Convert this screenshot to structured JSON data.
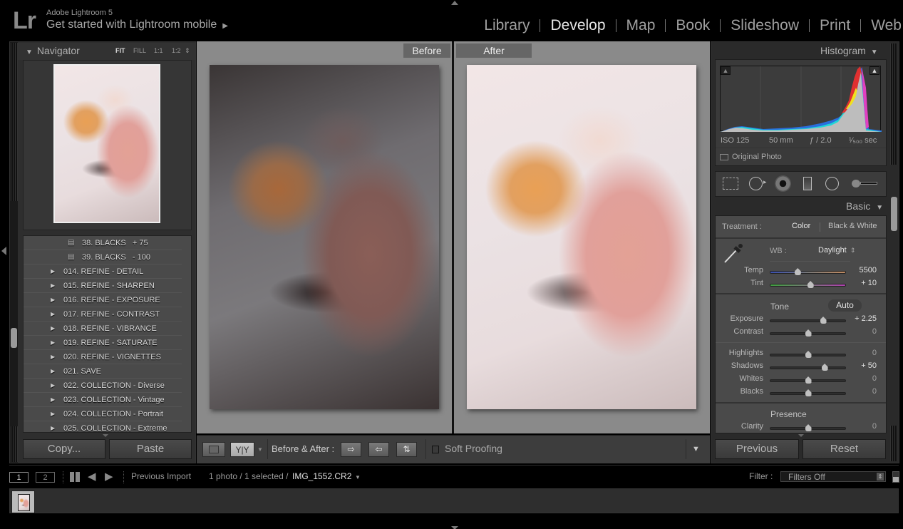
{
  "app": {
    "logo": "Lr",
    "name": "Adobe Lightroom 5",
    "mobile_link": "Get started with Lightroom mobile",
    "mobile_arrow": "▶"
  },
  "modules": [
    {
      "label": "Library",
      "active": false
    },
    {
      "label": "Develop",
      "active": true
    },
    {
      "label": "Map",
      "active": false
    },
    {
      "label": "Book",
      "active": false
    },
    {
      "label": "Slideshow",
      "active": false
    },
    {
      "label": "Print",
      "active": false
    },
    {
      "label": "Web",
      "active": false
    }
  ],
  "navigator": {
    "title": "Navigator",
    "zoom_options": [
      "FIT",
      "FILL",
      "1:1",
      "1:2"
    ],
    "active_zoom": "FIT"
  },
  "presets": [
    {
      "label": "38. BLACKS   + 75",
      "type": "preset"
    },
    {
      "label": "39. BLACKS   - 100",
      "type": "preset"
    },
    {
      "label": "014. REFINE - DETAIL",
      "type": "folder"
    },
    {
      "label": "015. REFINE - SHARPEN",
      "type": "folder"
    },
    {
      "label": "016. REFINE - EXPOSURE",
      "type": "folder"
    },
    {
      "label": "017. REFINE - CONTRAST",
      "type": "folder"
    },
    {
      "label": "018. REFINE - VIBRANCE",
      "type": "folder"
    },
    {
      "label": "019. REFINE - SATURATE",
      "type": "folder"
    },
    {
      "label": "020. REFINE - VIGNETTES",
      "type": "folder"
    },
    {
      "label": "021. SAVE",
      "type": "folder"
    },
    {
      "label": "022. COLLECTION - Diverse",
      "type": "folder"
    },
    {
      "label": "023. COLLECTION - Vintage",
      "type": "folder"
    },
    {
      "label": "024. COLLECTION - Portrait",
      "type": "folder"
    },
    {
      "label": "025. COLLECTION - Extreme",
      "type": "folder"
    }
  ],
  "left_buttons": {
    "copy": "Copy...",
    "paste": "Paste"
  },
  "view": {
    "before_label": "Before",
    "after_label": "After"
  },
  "toolbar": {
    "before_after_label": "Before & After :",
    "yy_label": "Y|Y",
    "soft_proofing_label": "Soft Proofing",
    "soft_proofing_checked": false
  },
  "histogram": {
    "title": "Histogram",
    "iso": "ISO 125",
    "focal": "50 mm",
    "aperture": "ƒ / 2.0",
    "shutter": "¹⁄₅₀₀ sec",
    "original_photo_label": "Original Photo",
    "original_photo_checked": false
  },
  "basic": {
    "title": "Basic",
    "treatment_label": "Treatment :",
    "treatment_color": "Color",
    "treatment_bw": "Black & White",
    "treatment_active": "Color",
    "wb_label": "WB :",
    "wb_value": "Daylight",
    "tone_label": "Tone",
    "auto_label": "Auto",
    "presence_label": "Presence",
    "sliders": [
      {
        "name": "Temp",
        "value": "5500",
        "position": 0.36
      },
      {
        "name": "Tint",
        "value": "+ 10",
        "position": 0.53
      },
      {
        "name": "Exposure",
        "value": "+ 2.25",
        "position": 0.7
      },
      {
        "name": "Contrast",
        "value": "0",
        "position": 0.5
      },
      {
        "name": "Highlights",
        "value": "0",
        "position": 0.5
      },
      {
        "name": "Shadows",
        "value": "+ 50",
        "position": 0.72
      },
      {
        "name": "Whites",
        "value": "0",
        "position": 0.5
      },
      {
        "name": "Blacks",
        "value": "0",
        "position": 0.5
      },
      {
        "name": "Clarity",
        "value": "0",
        "position": 0.5
      }
    ]
  },
  "right_buttons": {
    "previous": "Previous",
    "reset": "Reset"
  },
  "filmstrip": {
    "screen1": "1",
    "screen2": "2",
    "source": "Previous Import",
    "count": "1 photo / 1 selected /",
    "filename": "IMG_1552.CR2",
    "filter_label": "Filter :",
    "filter_value": "Filters Off"
  },
  "colors": {
    "background": "#000000",
    "panel": "#4a4a4a",
    "center_bg": "#8a8a8a",
    "text": "#b8b8b8",
    "active_module": "#e8e8e8"
  }
}
